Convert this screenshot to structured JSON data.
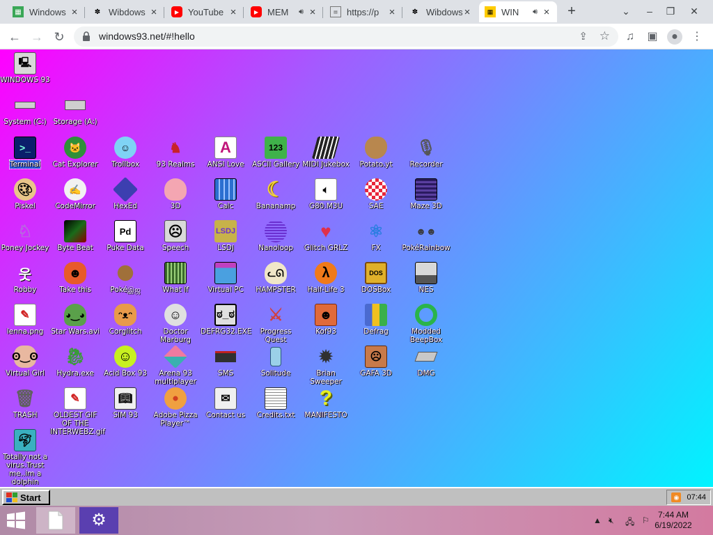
{
  "browser": {
    "tabs": [
      {
        "title": "Windows",
        "favicon": "windows-favicon",
        "color": "#3aa757"
      },
      {
        "title": "Wibdows",
        "favicon": "wibdows-favicon",
        "color": "#000000"
      },
      {
        "title": "YouTube",
        "favicon": "youtube-favicon",
        "color": "#ff0000"
      },
      {
        "title": "MEM",
        "favicon": "youtube-favicon",
        "color": "#ff0000"
      },
      {
        "title": "https://p",
        "favicon": "document-favicon",
        "color": "#555555"
      },
      {
        "title": "Wibdows",
        "favicon": "wibdows-favicon",
        "color": "#000000"
      },
      {
        "title": "WIN",
        "favicon": "win93-favicon",
        "color": "#ffcc00"
      }
    ],
    "url": "windows93.net/#!hello"
  },
  "desktop": {
    "icons": [
      {
        "label": "WINDOWS 93",
        "icon": "computer-icon",
        "color": "#d8d8d8"
      },
      {
        "label": "System (C:)",
        "icon": "hard-drive-icon",
        "color": "#cfcfcf"
      },
      {
        "label": "Storage (A:)",
        "icon": "floppy-drive-icon",
        "color": "#cfcfcf"
      },
      {
        "label": "Terminal",
        "icon": "terminal-icon",
        "color": "#0b1e6b"
      },
      {
        "label": "Cat Explorer",
        "icon": "cat-globe-icon",
        "color": "#2f8f3a"
      },
      {
        "label": "Trollbox",
        "icon": "chat-bubble-icon",
        "color": "#7fd3f5"
      },
      {
        "label": "93 Realms",
        "icon": "realms-icon",
        "color": "#c8222a"
      },
      {
        "label": "ANSI Love",
        "icon": "letter-a-icon",
        "color": "#ffffff"
      },
      {
        "label": "ASCII Gallery",
        "icon": "ascii-123-icon",
        "color": "#3fb24a"
      },
      {
        "label": "MIDI Jukebox",
        "icon": "piano-icon",
        "color": "#222222"
      },
      {
        "label": "Potato.yt",
        "icon": "potato-icon",
        "color": "#b8874e"
      },
      {
        "label": "Recorder",
        "icon": "microphone-icon",
        "color": "#8a8a8a"
      },
      {
        "label": "Piskel",
        "icon": "palette-icon",
        "color": "#e9c58a"
      },
      {
        "label": "CodeMirror",
        "icon": "codemirror-icon",
        "color": "#f2f2f2"
      },
      {
        "label": "HexEd",
        "icon": "cube-icon",
        "color": "#3d3fb0"
      },
      {
        "label": "3D",
        "icon": "teapot-icon",
        "color": "#f4a6b2"
      },
      {
        "label": "Calc",
        "icon": "calculator-icon",
        "color": "#2c6fd0"
      },
      {
        "label": "Bananamp",
        "icon": "banana-icon",
        "color": "#f2d23a"
      },
      {
        "label": "G80.M3U",
        "icon": "playlist-icon",
        "color": "#ffffff"
      },
      {
        "label": "SAE",
        "icon": "checker-ball-icon",
        "color": "#e8263a"
      },
      {
        "label": "Maze 3D",
        "icon": "maze-icon",
        "color": "#5a3fa0"
      },
      {
        "label": "Poney Jockey",
        "icon": "pony-icon",
        "color": "#b76adf"
      },
      {
        "label": "Byte Beat",
        "icon": "bytebeat-icon",
        "color": "#1a6b1a"
      },
      {
        "label": "Puke Data",
        "icon": "puke-data-icon",
        "color": "#ffffff"
      },
      {
        "label": "Speech",
        "icon": "face-icon",
        "color": "#d9d9d9"
      },
      {
        "label": "LSDJ",
        "icon": "gameboy-icon",
        "color": "#c7b24a"
      },
      {
        "label": "Nanoloop",
        "icon": "nanoloop-icon",
        "color": "#6a2fd0"
      },
      {
        "label": "Glitch GRLZ",
        "icon": "lips-icon",
        "color": "#e0304a"
      },
      {
        "label": "FX",
        "icon": "atom-icon",
        "color": "#2a7de0"
      },
      {
        "label": "PokéRainbow",
        "icon": "trainers-icon",
        "color": "#5a8a4a"
      },
      {
        "label": "Robby",
        "icon": "stick-figure-icon",
        "color": "#ffffff"
      },
      {
        "label": "Take this",
        "icon": "bird-icon",
        "color": "#e85a2a"
      },
      {
        "label": "Pokéஇஜ",
        "icon": "pokemon-icon",
        "color": "#a0703a"
      },
      {
        "label": "What If",
        "icon": "what-if-icon",
        "color": "#3a6a2a"
      },
      {
        "label": "Virtual PC",
        "icon": "virtual-pc-icon",
        "color": "#4aa0e0"
      },
      {
        "label": "HAMPSTER",
        "icon": "hamster-icon",
        "color": "#f0e6c8"
      },
      {
        "label": "Half-Life 3",
        "icon": "lambda-icon",
        "color": "#f07a1a"
      },
      {
        "label": "DOSBox",
        "icon": "dosbox-icon",
        "color": "#e0b02a"
      },
      {
        "label": "NES",
        "icon": "nes-icon",
        "color": "#d8d8d8"
      },
      {
        "label": "lenna.png",
        "icon": "image-file-icon",
        "color": "#ffffff"
      },
      {
        "label": "Star Wars.avi",
        "icon": "yoda-icon",
        "color": "#5aa04a"
      },
      {
        "label": "Corglitch",
        "icon": "corgi-icon",
        "color": "#e89a4a"
      },
      {
        "label": "Doctor Marburg",
        "icon": "doctor-icon",
        "color": "#e0e0e0"
      },
      {
        "label": "DEFRG32.EXE",
        "icon": "defrag-monitor-icon",
        "color": "#e0e0e0"
      },
      {
        "label": "Progress Quest",
        "icon": "crossed-swords-icon",
        "color": "#d04040"
      },
      {
        "label": "Kof93",
        "icon": "fighter-icon",
        "color": "#e06a3a"
      },
      {
        "label": "Defrag",
        "icon": "defrag-icon",
        "color": "#4a6ad0"
      },
      {
        "label": "Modded BeepBox",
        "icon": "ring-icon",
        "color": "#2ab44a"
      },
      {
        "label": "Virtual Girl",
        "icon": "girl-face-icon",
        "color": "#e8b8a0"
      },
      {
        "label": "Hydra.exe",
        "icon": "hydra-icon",
        "color": "#3a9a3a"
      },
      {
        "label": "Acid Box 93",
        "icon": "smiley-icon",
        "color": "#c8f020"
      },
      {
        "label": "Arena 93 multiplayer",
        "icon": "arena-cube-icon",
        "color": "#3ab0b0"
      },
      {
        "label": "SMS",
        "icon": "sms-console-icon",
        "color": "#303030"
      },
      {
        "label": "Solitude",
        "icon": "solitude-icon",
        "color": "#9ad0e8"
      },
      {
        "label": "Brian Sweeper",
        "icon": "mine-icon",
        "color": "#404040"
      },
      {
        "label": "GAFA 3D",
        "icon": "gafa-face-icon",
        "color": "#c87a4a"
      },
      {
        "label": "DMG",
        "icon": "dmg-icon",
        "color": "#c8c8c8"
      },
      {
        "label": "TRASH",
        "icon": "trash-icon",
        "color": "#d0d0d0"
      },
      {
        "label": "OLDEST GIF OF THE INTERWEBZ.gif",
        "icon": "gif-file-icon",
        "color": "#ffffff"
      },
      {
        "label": "SIM 93",
        "icon": "book-icon",
        "color": "#f0f0f0"
      },
      {
        "label": "Adobe Pizza Player™",
        "icon": "pizza-icon",
        "color": "#f0a040"
      },
      {
        "label": "Contact us",
        "icon": "contact-icon",
        "color": "#f0f0f0"
      },
      {
        "label": "Credits.txt",
        "icon": "text-file-icon",
        "color": "#ffffff"
      },
      {
        "label": "MANIFESTO",
        "icon": "question-mark-icon",
        "color": "#e8f020"
      },
      {
        "label": "Totally not a virus.Trust me..im a dolphin",
        "icon": "dolphin-icon",
        "color": "#3ab0c0"
      }
    ]
  },
  "taskbar93": {
    "start_label": "Start",
    "clock": "07:44"
  },
  "host_taskbar": {
    "time": "7:44 AM",
    "date": "6/19/2022"
  }
}
